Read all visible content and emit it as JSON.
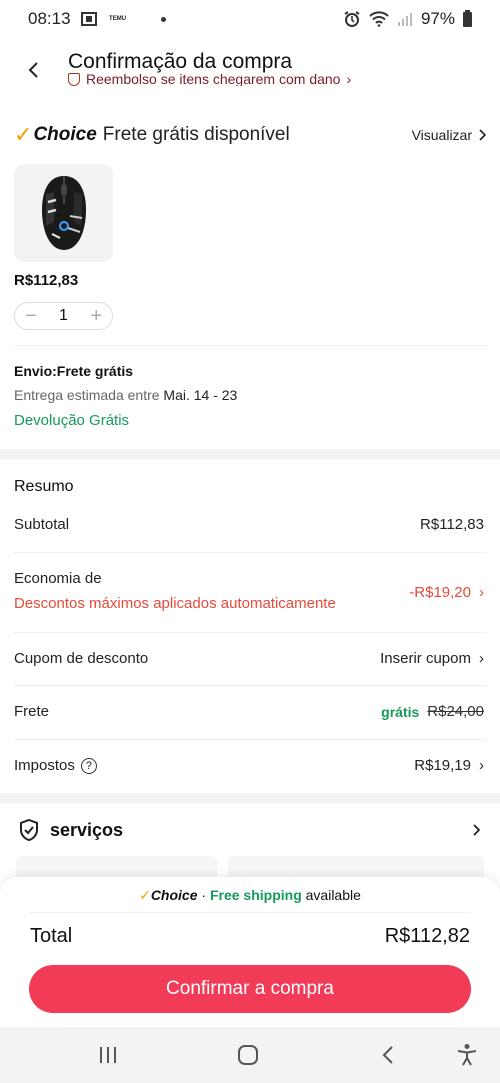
{
  "status": {
    "time": "08:13",
    "app_tag": "TEMU",
    "battery": "97%"
  },
  "header": {
    "title": "Confirmação da compra",
    "banner": "Reembolso se itens chegarem com dano"
  },
  "choice": {
    "logo": "Choice",
    "text": "Frete grátis disponível",
    "view_label": "Visualizar"
  },
  "product": {
    "price": "R$112,83",
    "quantity": "1"
  },
  "shipping": {
    "title": "Envio:Frete grátis",
    "date_prefix": "Entrega estimada entre",
    "date_range": "Mai. 14 - 23",
    "returns": "Devolução Grátis"
  },
  "summary": {
    "title": "Resumo",
    "subtotal_label": "Subtotal",
    "subtotal_value": "R$112,83",
    "savings_label": "Economia de",
    "savings_note": "Descontos máximos aplicados automaticamente",
    "savings_value": "-R$19,20",
    "coupon_label": "Cupom de desconto",
    "coupon_value": "Inserir cupom",
    "freight_label": "Frete",
    "freight_free": "grátis",
    "freight_original": "R$24,00",
    "tax_label": "Impostos",
    "tax_value": "R$19,19"
  },
  "services": {
    "title": "serviços"
  },
  "footer": {
    "choice_logo": "Choice",
    "choice_sep": " · ",
    "free_shipping": "Free shipping",
    "available": " available",
    "total_label": "Total",
    "total_value": "R$112,82",
    "confirm_label": "Confirmar a compra"
  },
  "colors": {
    "accent": "#f23b57",
    "green": "#179a5a",
    "red": "#e84a3a",
    "choice_check": "#f5a100"
  }
}
